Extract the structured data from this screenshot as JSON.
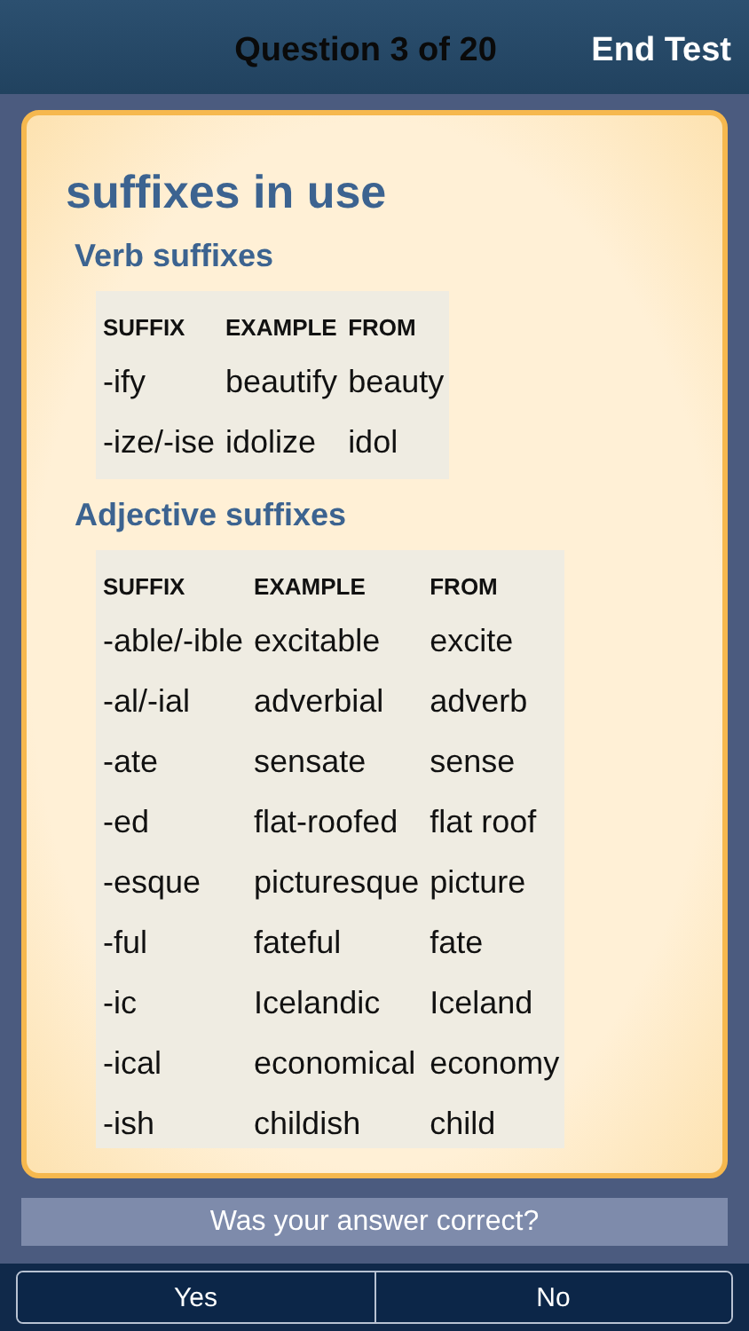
{
  "nav_bar": {
    "title": "Question 3 of 20",
    "end_button": "End Test"
  },
  "card": {
    "heading": "suffixes in use",
    "sections": [
      {
        "title": "Verb suffixes",
        "columns": [
          "SUFFIX",
          "EXAMPLE",
          "FROM"
        ],
        "rows": [
          [
            "-ify",
            "beautify",
            "beauty"
          ],
          [
            "-ize/-ise",
            "idolize",
            "idol"
          ]
        ]
      },
      {
        "title": "Adjective suffixes",
        "columns": [
          "SUFFIX",
          "EXAMPLE",
          "FROM"
        ],
        "rows": [
          [
            "-able/-ible",
            "excitable",
            "excite"
          ],
          [
            "-al/-ial",
            "adverbial",
            "adverb"
          ],
          [
            "-ate",
            "sensate",
            "sense"
          ],
          [
            "-ed",
            "flat-roofed",
            "flat roof"
          ],
          [
            "-esque",
            "picturesque",
            "picture"
          ],
          [
            "-ful",
            "fateful",
            "fate"
          ],
          [
            "-ic",
            "Icelandic",
            "Iceland"
          ],
          [
            "-ical",
            "economical",
            "economy"
          ],
          [
            "-ish",
            "childish",
            "child"
          ]
        ]
      }
    ]
  },
  "prompt": "Was your answer correct?",
  "answer_buttons": [
    "Yes",
    "No"
  ]
}
